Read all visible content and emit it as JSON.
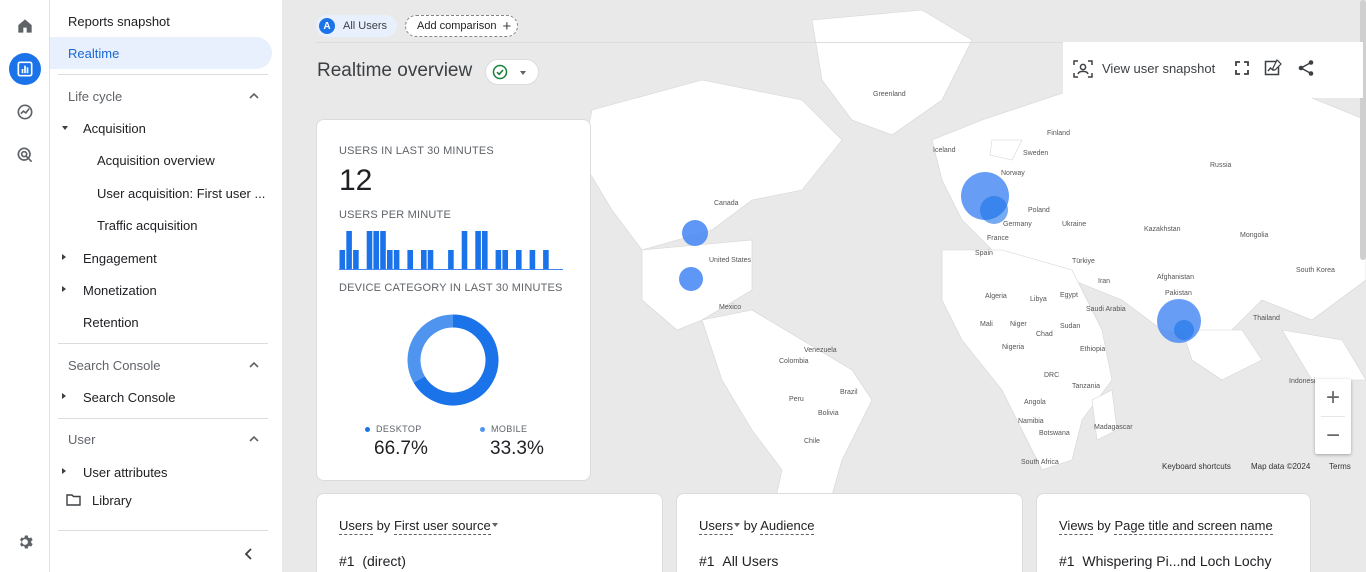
{
  "nav": {
    "reports_snapshot": "Reports snapshot",
    "realtime": "Realtime",
    "lifecycle_section": "Life cycle",
    "acquisition": "Acquisition",
    "acquisition_overview": "Acquisition overview",
    "user_acquisition": "User acquisition: First user ...",
    "traffic_acquisition": "Traffic acquisition",
    "engagement": "Engagement",
    "monetization": "Monetization",
    "retention": "Retention",
    "search_console_section": "Search Console",
    "search_console_item": "Search Console",
    "user_section": "User",
    "user_attributes": "User attributes",
    "library": "Library"
  },
  "header": {
    "chip_letter": "A",
    "chip_label": "All Users",
    "add_comparison": "Add comparison",
    "title": "Realtime overview",
    "view_user_snapshot": "View user snapshot"
  },
  "summary_card": {
    "users_30_label": "USERS IN LAST 30 MINUTES",
    "users_30_value": "12",
    "users_per_minute_label": "USERS PER MINUTE",
    "device_label": "DEVICE CATEGORY IN LAST 30 MINUTES",
    "desktop_label": "DESKTOP",
    "desktop_value": "66.7%",
    "mobile_label": "MOBILE",
    "mobile_value": "33.3%"
  },
  "chart_data": [
    {
      "type": "bar",
      "title": "USERS PER MINUTE",
      "values": [
        1,
        2,
        1,
        0,
        2,
        2,
        2,
        1,
        1,
        0,
        1,
        0,
        1,
        1,
        0,
        0,
        1,
        0,
        2,
        0,
        2,
        2,
        0,
        1,
        1,
        0,
        1,
        0,
        1,
        0,
        1,
        0,
        0
      ],
      "ylim": [
        0,
        2
      ]
    },
    {
      "type": "pie",
      "title": "DEVICE CATEGORY IN LAST 30 MINUTES",
      "categories": [
        "DESKTOP",
        "MOBILE"
      ],
      "values": [
        66.7,
        33.3
      ],
      "colors": [
        "#1a73e8",
        "#4f95ef"
      ]
    }
  ],
  "bottom_cards": [
    {
      "metric": "Users",
      "by": "by",
      "dimension": "First user source",
      "row_rank": "#1",
      "row_value": "(direct)"
    },
    {
      "metric": "Users",
      "by": "by",
      "dimension": "Audience",
      "row_rank": "#1",
      "row_value": "All Users"
    },
    {
      "metric": "Views",
      "by": "by",
      "dimension": "Page title and screen name",
      "row_rank": "#1",
      "row_value": "Whispering Pi...nd Loch Lochy"
    }
  ],
  "map": {
    "labels": [
      "Greenland",
      "Iceland",
      "Finland",
      "Sweden",
      "Norway",
      "Russia",
      "Canada",
      "Poland",
      "Germany",
      "Ukraine",
      "Kazakhstan",
      "Mongolia",
      "France",
      "Spain",
      "Türkiye",
      "United States",
      "South Korea",
      "Afghanistan",
      "Iran",
      "Pakistan",
      "Algeria",
      "Libya",
      "Egypt",
      "Saudi Arabia",
      "Mexico",
      "Mali",
      "Niger",
      "Chad",
      "Sudan",
      "Thailand",
      "Nigeria",
      "Ethiopia",
      "Venezuela",
      "Colombia",
      "DRC",
      "Tanzania",
      "Indonesia",
      "Peru",
      "Brazil",
      "Angola",
      "Bolivia",
      "Namibia",
      "Botswana",
      "Madagascar",
      "Chile",
      "South Africa"
    ],
    "keyboard_shortcuts": "Keyboard shortcuts",
    "map_data": "Map data ©2024",
    "terms": "Terms",
    "zoom_in": "+",
    "zoom_out": "−"
  },
  "colors": {
    "accent": "#1a73e8",
    "bubble": "#4285f4"
  }
}
